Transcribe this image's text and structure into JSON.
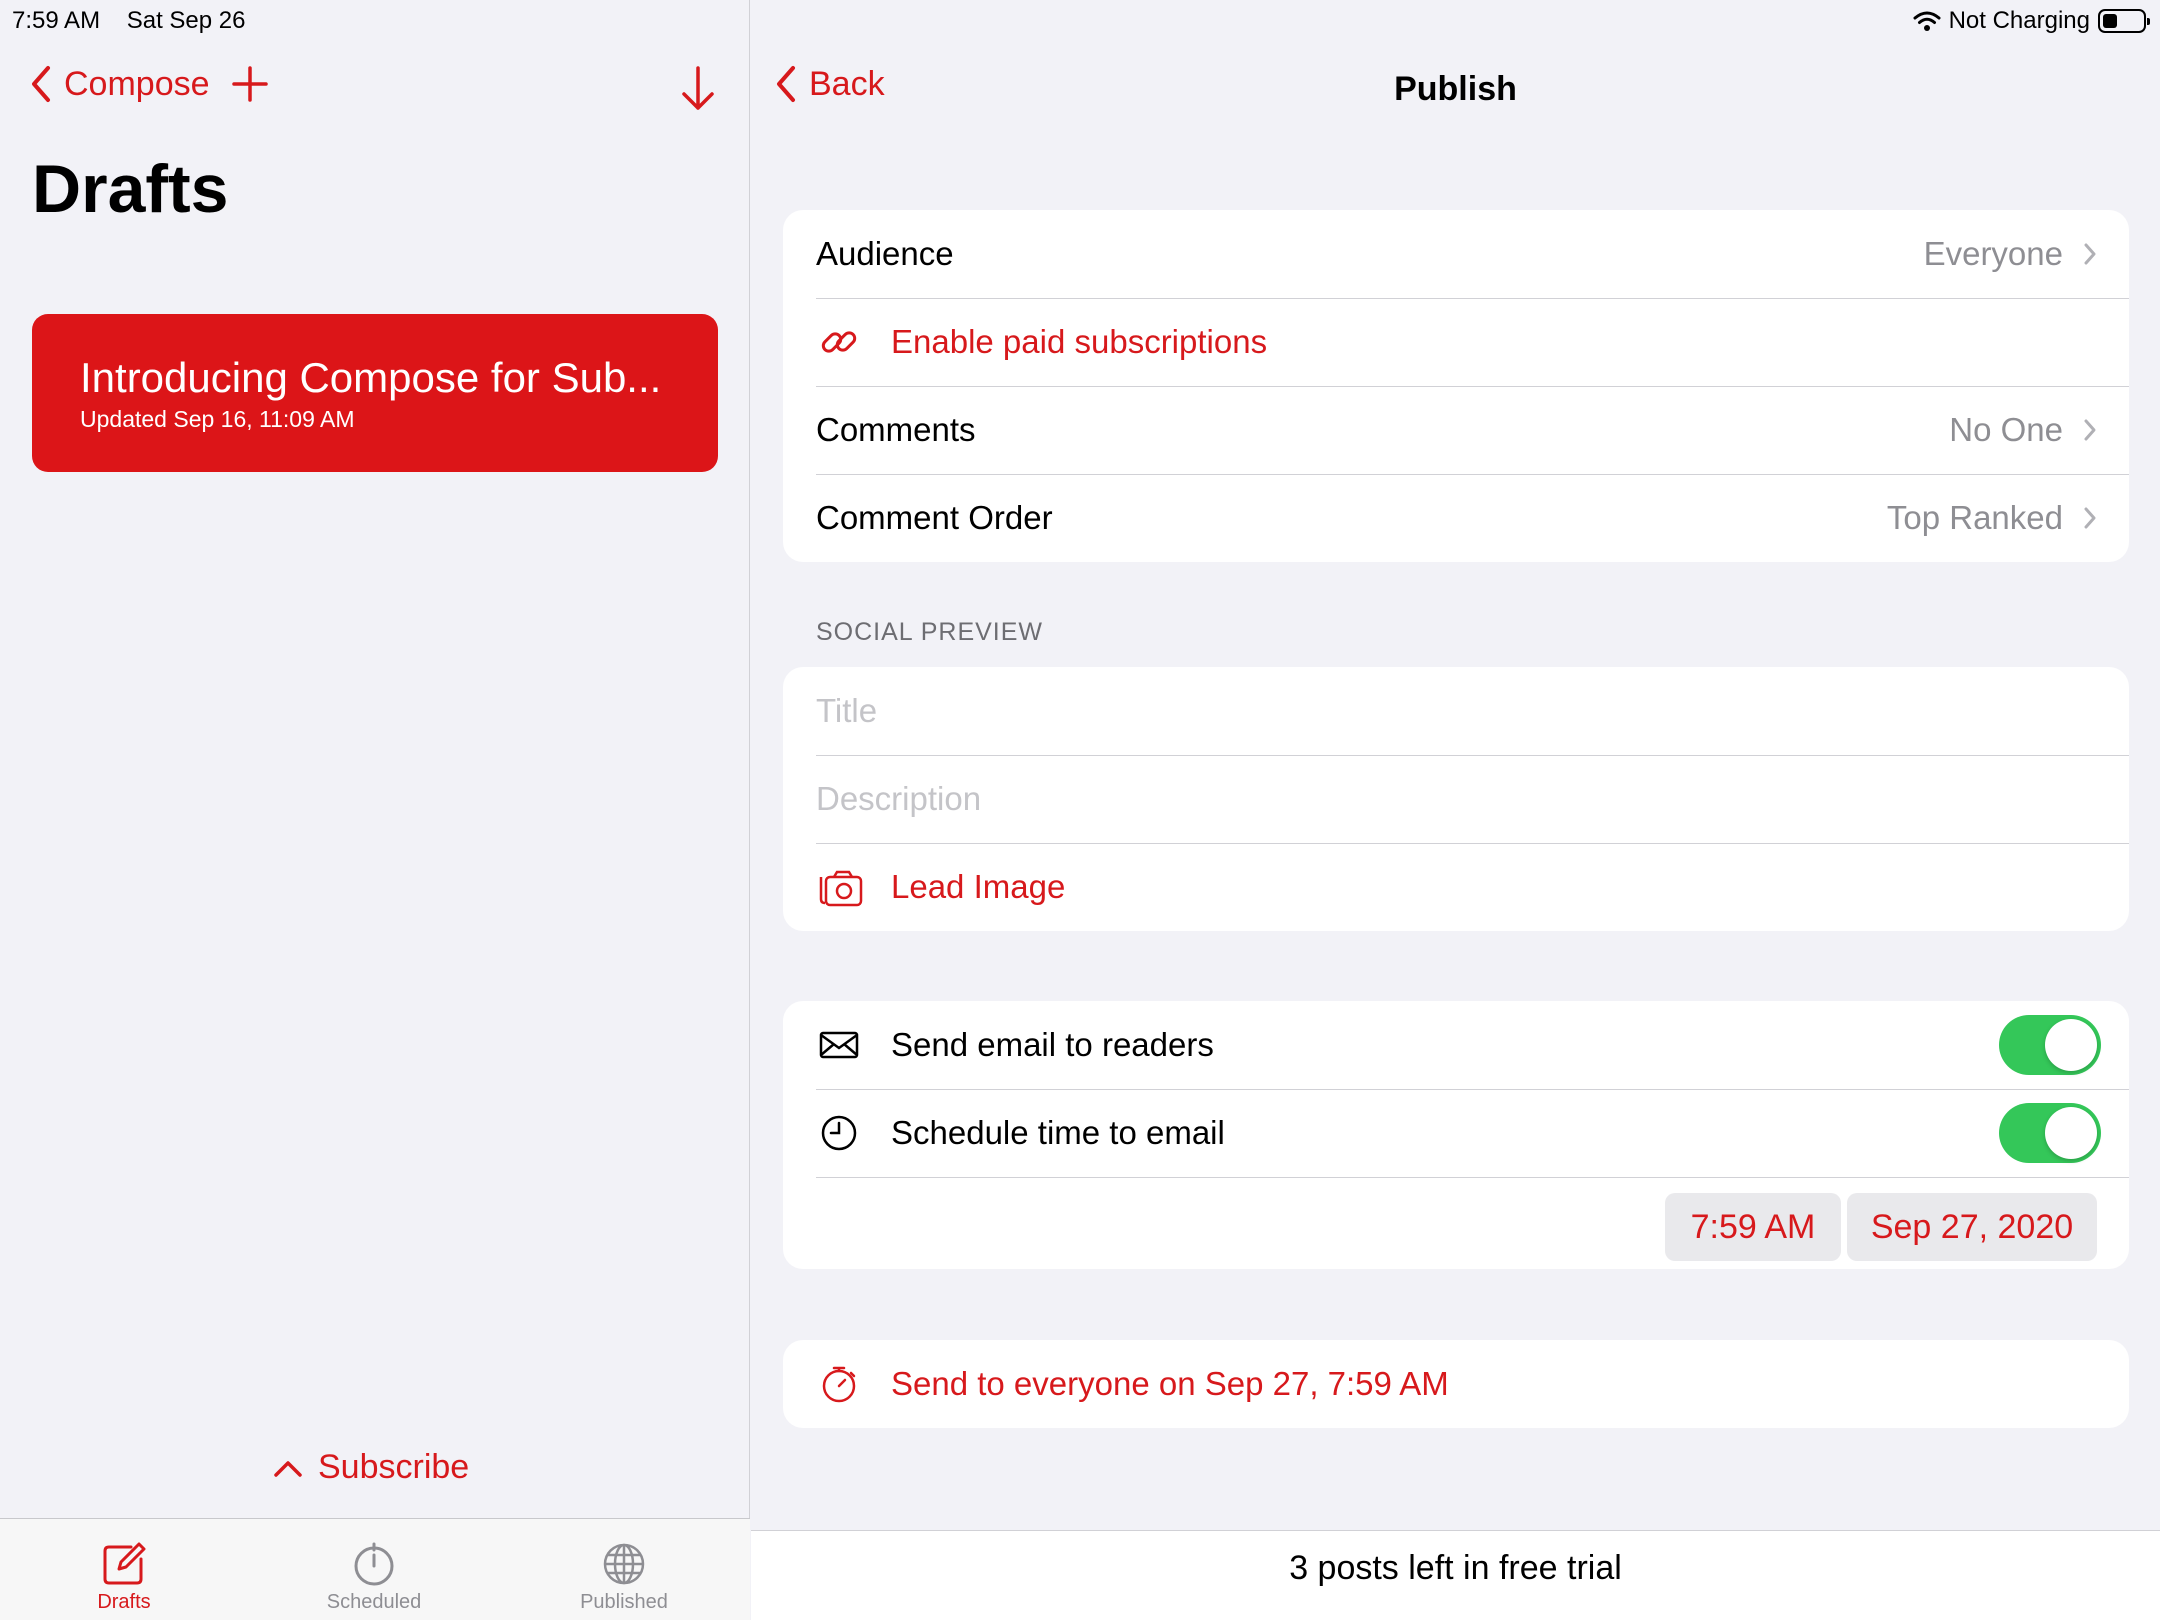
{
  "status_bar": {
    "time": "7:59 AM",
    "date": "Sat Sep 26",
    "charging": "Not Charging"
  },
  "sidebar": {
    "back_label": "Compose",
    "title": "Drafts",
    "draft": {
      "title": "Introducing Compose for Sub...",
      "updated": "Updated Sep 16, 11:09 AM"
    },
    "subscribe_label": "Subscribe",
    "tabs": [
      {
        "label": "Drafts",
        "icon": "compose-icon",
        "active": true
      },
      {
        "label": "Scheduled",
        "icon": "stopwatch-icon",
        "active": false
      },
      {
        "label": "Published",
        "icon": "globe-icon",
        "active": false
      }
    ]
  },
  "detail": {
    "back_label": "Back",
    "title": "Publish",
    "settings": [
      {
        "label": "Audience",
        "value": "Everyone"
      },
      {
        "label": "Enable paid subscriptions",
        "icon": "link-icon"
      },
      {
        "label": "Comments",
        "value": "No One"
      },
      {
        "label": "Comment Order",
        "value": "Top Ranked"
      }
    ],
    "social_preview": {
      "header": "SOCIAL PREVIEW",
      "title_placeholder": "Title",
      "description_placeholder": "Description",
      "lead_image_label": "Lead Image"
    },
    "email": {
      "send_label": "Send email to readers",
      "send_enabled": true,
      "schedule_label": "Schedule time to email",
      "schedule_enabled": true,
      "time": "7:59 AM",
      "date": "Sep 27, 2020"
    },
    "send_button_label": "Send to everyone on Sep 27, 7:59 AM",
    "footer_text": "3 posts left in free trial"
  },
  "colors": {
    "accent": "#d7191c",
    "toggle_on": "#34c759",
    "background": "#f2f2f7"
  }
}
